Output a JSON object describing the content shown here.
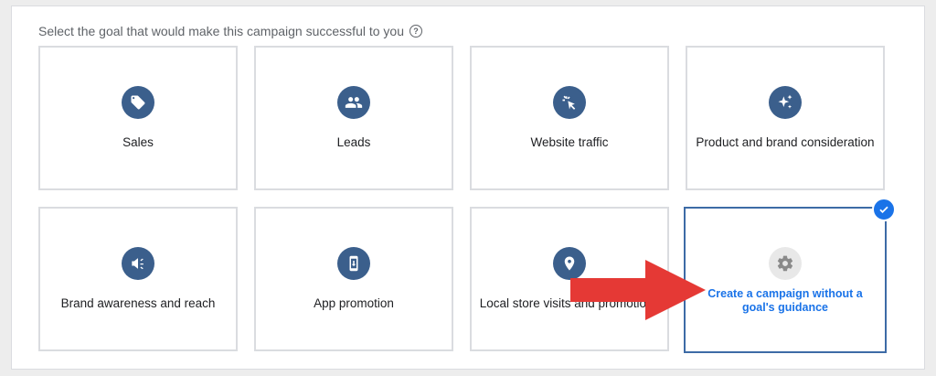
{
  "heading": "Select the goal that would make this campaign successful to you",
  "help_icon": "question-circle-icon",
  "goals": [
    {
      "label": "Sales",
      "icon": "tag-icon"
    },
    {
      "label": "Leads",
      "icon": "people-icon"
    },
    {
      "label": "Website traffic",
      "icon": "cursor-click-icon"
    },
    {
      "label": "Product and brand consideration",
      "icon": "sparkle-icon"
    },
    {
      "label": "Brand awareness and reach",
      "icon": "speaker-icon"
    },
    {
      "label": "App promotion",
      "icon": "phone-download-icon"
    },
    {
      "label": "Local store visits and promotions",
      "icon": "location-pin-icon"
    },
    {
      "label": "Create a campaign without a goal's guidance",
      "icon": "gear-icon",
      "selected": true
    }
  ],
  "colors": {
    "icon_bg": "#3b5f8c",
    "selected_border": "#3d6ba6",
    "selected_text": "#1a73e8",
    "arrow": "#e53935"
  }
}
